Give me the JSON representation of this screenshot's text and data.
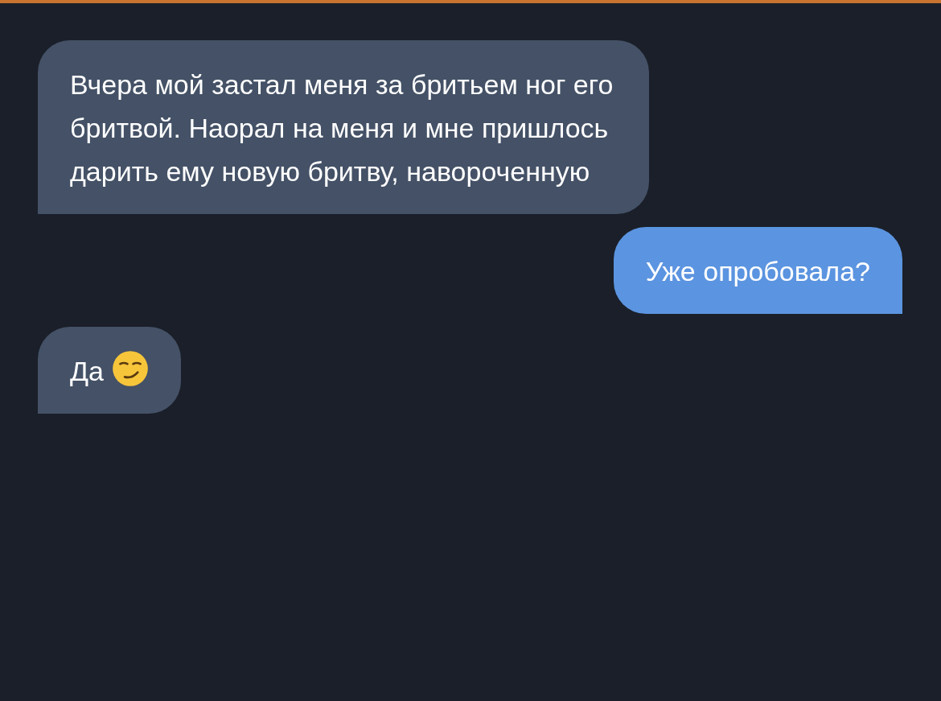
{
  "messages": [
    {
      "kind": "incoming",
      "text": "Вчера мой застал меня за бритьем ног его бритвой. Наорал на меня и мне пришлось дарить ему новую бритву, навороченную"
    },
    {
      "kind": "outgoing",
      "text": "Уже опробовала?"
    },
    {
      "kind": "incoming",
      "text": "Да",
      "emoji_shown": true
    }
  ]
}
